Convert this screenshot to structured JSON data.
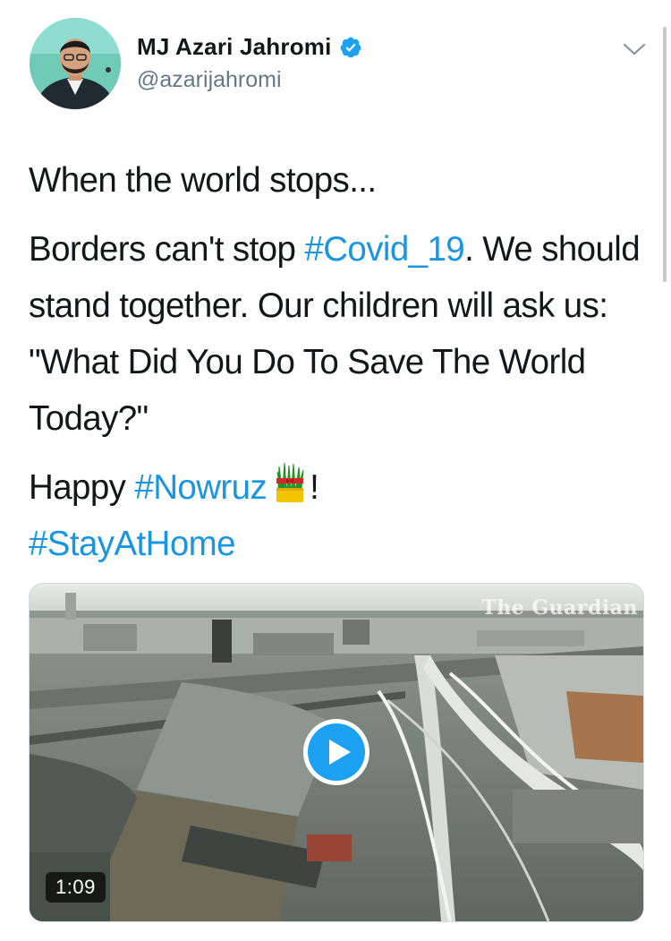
{
  "user": {
    "name": "MJ Azari Jahromi",
    "handle": "@azarijahromi",
    "verified": true
  },
  "tweet": {
    "line1": "When the world stops...",
    "p2_before": "Borders can't stop ",
    "p2_hashtag": "#Covid_19",
    "p2_after": ". We should stand together. Our children will ask us: \"What Did You Do To Save The World Today?\"",
    "p3_before": "Happy ",
    "p3_hashtag": "#Nowruz",
    "p3_emoji": "sabzeh-grass-emoji",
    "p3_after": "!",
    "p4_hashtag": "#StayAtHome"
  },
  "media": {
    "watermark": "The Guardian",
    "duration": "1:09",
    "play_icon": "play-icon"
  },
  "colors": {
    "hashtag": "#1b95e0",
    "verified": "#1da1f2",
    "text": "#14171a",
    "secondary": "#657786"
  }
}
